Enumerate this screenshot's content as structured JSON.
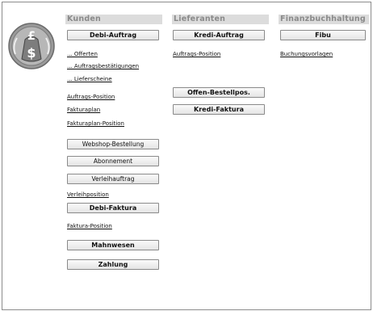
{
  "columns": {
    "kunden": {
      "header": "Kunden",
      "main_button": "Debi-Auftrag",
      "links_top": [
        "... Offerten",
        "... Auftragsbestätigungen",
        "... Lieferscheine"
      ],
      "links_mid": [
        "Auftrags-Position",
        "Fakturaplan",
        "Fakturaplan-Position"
      ],
      "buttons_small": [
        "Webshop-Bestellung",
        "Abonnement",
        "Verleihauftrag"
      ],
      "link_verleih": "Verleihposition",
      "button_faktura": "Debi-Faktura",
      "link_faktura_pos": "Faktura-Position",
      "button_mahnwesen": "Mahnwesen",
      "button_zahlung": "Zahlung"
    },
    "lieferanten": {
      "header": "Lieferanten",
      "main_button": "Kredi-Auftrag",
      "link_pos": "Auftrags-Position",
      "button_offen": "Offen-Bestellpos.",
      "button_faktura": "Kredi-Faktura"
    },
    "fibu": {
      "header": "Finanzbuchhaltung",
      "main_button": "Fibu",
      "link_vorlagen": "Buchungsvorlagen"
    }
  },
  "logo": {
    "icon": "money-bag-laurel-icon",
    "colors": {
      "fill": "#8f8f8f",
      "outline": "#5a5a5a"
    }
  }
}
